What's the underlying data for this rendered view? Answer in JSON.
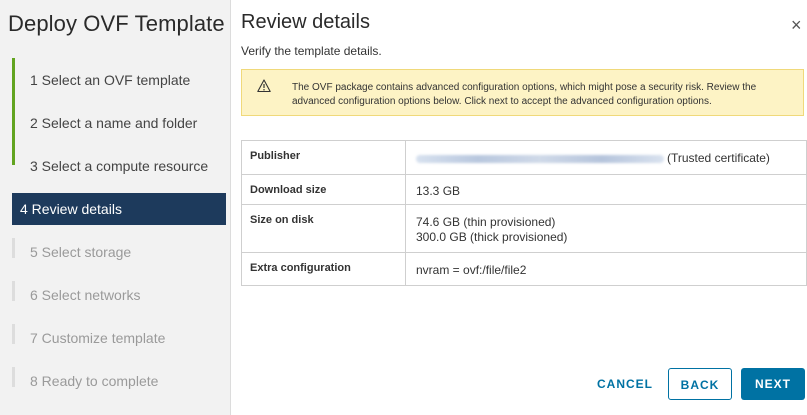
{
  "wizard": {
    "title": "Deploy OVF Template",
    "steps": [
      {
        "label": "1  Select an OVF template",
        "state": "done"
      },
      {
        "label": "2  Select a name and folder",
        "state": "done"
      },
      {
        "label": "3  Select a compute resource",
        "state": "done"
      },
      {
        "label": "4  Review details",
        "state": "active"
      },
      {
        "label": "5  Select storage",
        "state": "future"
      },
      {
        "label": "6  Select networks",
        "state": "future"
      },
      {
        "label": "7  Customize template",
        "state": "future"
      },
      {
        "label": "8  Ready to complete",
        "state": "future"
      }
    ]
  },
  "page": {
    "title": "Review details",
    "close_glyph": "×",
    "subtitle": "Verify the template details."
  },
  "alert": {
    "icon": "warning-triangle-icon",
    "text": "The OVF package contains advanced configuration options, which might pose a security risk. Review the advanced configuration options below. Click next to accept the advanced configuration options."
  },
  "details": {
    "publisher_label": "Publisher",
    "publisher_note": "(Trusted certificate)",
    "download_size_label": "Download size",
    "download_size_value": "13.3 GB",
    "size_on_disk_label": "Size on disk",
    "size_on_disk_thin": "74.6 GB (thin provisioned)",
    "size_on_disk_thick": "300.0 GB (thick provisioned)",
    "extra_config_label": "Extra configuration",
    "extra_config_value": "nvram = ovf:/file/file2"
  },
  "buttons": {
    "cancel": "CANCEL",
    "back": "BACK",
    "next": "NEXT"
  },
  "colors": {
    "active_step_bg": "#1d3a5c",
    "progress_green": "#62a420",
    "primary_blue": "#0072a3",
    "alert_bg": "#fdf3c5"
  }
}
